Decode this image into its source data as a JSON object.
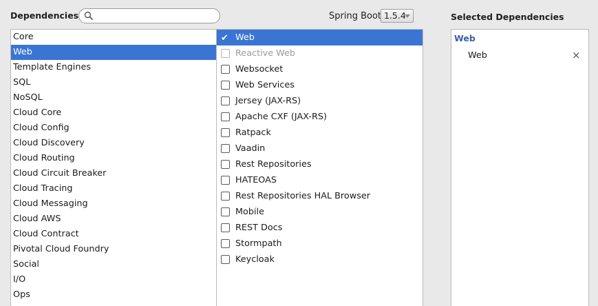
{
  "header": {
    "dependencies_title": "Dependencies",
    "selected_title": "Selected Dependencies",
    "search": {
      "value": "",
      "placeholder": ""
    },
    "spring_boot_label": "Spring Boot",
    "spring_boot_version": "1.5.4"
  },
  "categories": [
    "Core",
    "Web",
    "Template Engines",
    "SQL",
    "NoSQL",
    "Cloud Core",
    "Cloud Config",
    "Cloud Discovery",
    "Cloud Routing",
    "Cloud Circuit Breaker",
    "Cloud Tracing",
    "Cloud Messaging",
    "Cloud AWS",
    "Cloud Contract",
    "Pivotal Cloud Foundry",
    "Social",
    "I/O",
    "Ops"
  ],
  "selected_category_index": 1,
  "items": [
    {
      "label": "Web",
      "checked": true,
      "disabled": false,
      "selected": true
    },
    {
      "label": "Reactive Web",
      "checked": false,
      "disabled": true,
      "selected": false
    },
    {
      "label": "Websocket",
      "checked": false,
      "disabled": false,
      "selected": false
    },
    {
      "label": "Web Services",
      "checked": false,
      "disabled": false,
      "selected": false
    },
    {
      "label": "Jersey (JAX-RS)",
      "checked": false,
      "disabled": false,
      "selected": false
    },
    {
      "label": "Apache CXF (JAX-RS)",
      "checked": false,
      "disabled": false,
      "selected": false
    },
    {
      "label": "Ratpack",
      "checked": false,
      "disabled": false,
      "selected": false
    },
    {
      "label": "Vaadin",
      "checked": false,
      "disabled": false,
      "selected": false
    },
    {
      "label": "Rest Repositories",
      "checked": false,
      "disabled": false,
      "selected": false
    },
    {
      "label": "HATEOAS",
      "checked": false,
      "disabled": false,
      "selected": false
    },
    {
      "label": "Rest Repositories HAL Browser",
      "checked": false,
      "disabled": false,
      "selected": false
    },
    {
      "label": "Mobile",
      "checked": false,
      "disabled": false,
      "selected": false
    },
    {
      "label": "REST Docs",
      "checked": false,
      "disabled": false,
      "selected": false
    },
    {
      "label": "Stormpath",
      "checked": false,
      "disabled": false,
      "selected": false
    },
    {
      "label": "Keycloak",
      "checked": false,
      "disabled": false,
      "selected": false
    }
  ],
  "selected_dependencies": {
    "group": "Web",
    "items": [
      {
        "label": "Web",
        "remove_icon": "close-icon",
        "remove_glyph": "×"
      }
    ]
  },
  "icons": {
    "search": "search-icon",
    "check": "check-icon",
    "dropdown": "chevron-down-icon"
  },
  "colors": {
    "selection": "#3a75d4",
    "group_header": "#3a5ea8",
    "background": "#e9e9e9"
  }
}
